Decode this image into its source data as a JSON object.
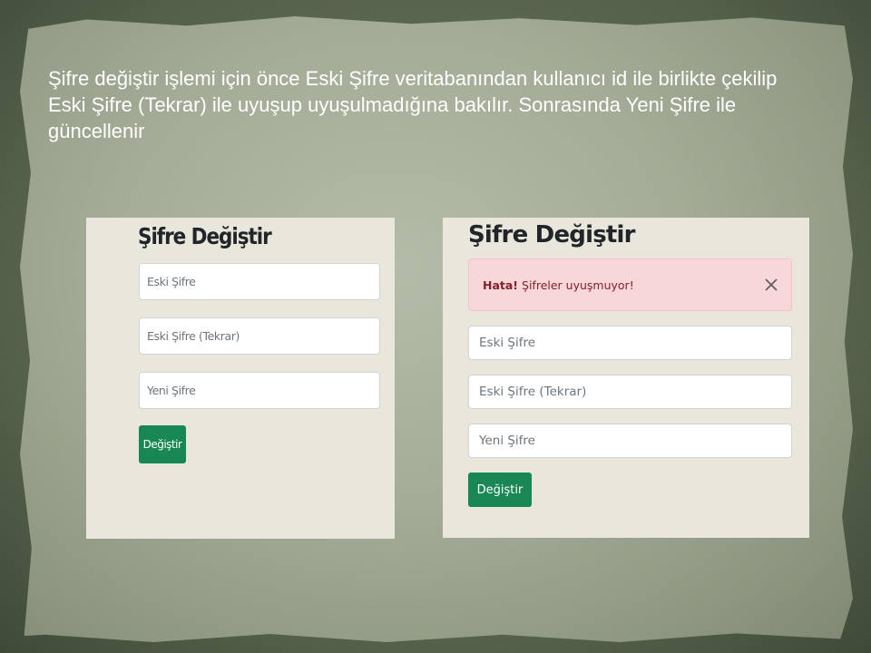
{
  "caption": "Şifre değiştir işlemi için önce Eski Şifre veritabanından kullanıcı id ile birlikte çekilip Eski Şifre (Tekrar) ile uyuşup uyuşulmadığına bakılır. Sonrasında Yeni Şifre ile güncellenir",
  "left_form": {
    "title": "Şifre Değiştir",
    "old_password_placeholder": "Eski Şifre",
    "old_password_repeat_placeholder": "Eski Şifre (Tekrar)",
    "new_password_placeholder": "Yeni Şifre",
    "submit_label": "Değiştir"
  },
  "right_form": {
    "title": "Şifre Değiştir",
    "alert": {
      "strong": "Hata!",
      "message": "Şifreler uyuşmuyor!",
      "close_icon": "close-icon"
    },
    "old_password_placeholder": "Eski Şifre",
    "old_password_repeat_placeholder": "Eski Şifre (Tekrar)",
    "new_password_placeholder": "Yeni Şifre",
    "submit_label": "Değiştir"
  },
  "colors": {
    "button": "#198754",
    "alert_bg": "#f8d7da",
    "alert_text": "#842029",
    "panel_bg": "#e9e7dc"
  }
}
